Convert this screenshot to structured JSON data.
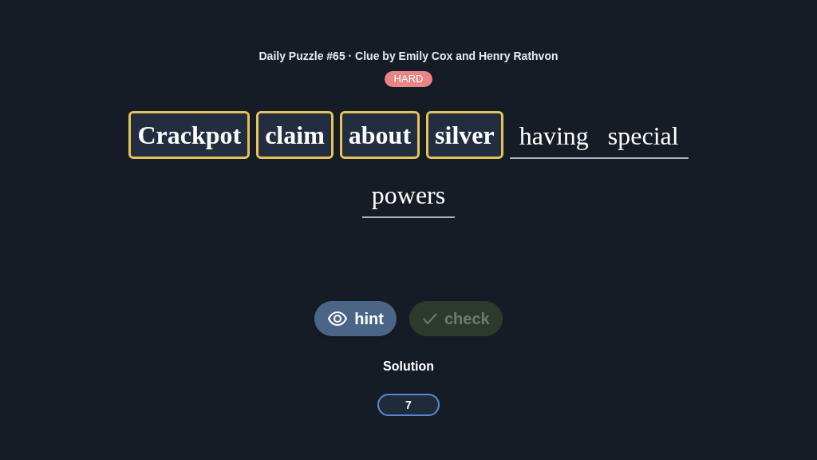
{
  "header": {
    "title": "Daily Puzzle #65 · Clue by Emily Cox and Henry Rathvon",
    "difficulty": "HARD"
  },
  "clue_lines": [
    [
      {
        "kind": "wordplay",
        "text": "Crackpot"
      },
      {
        "kind": "wordplay",
        "text": "claim"
      },
      {
        "kind": "wordplay",
        "text": "about"
      },
      {
        "kind": "wordplay",
        "text": "silver"
      },
      {
        "kind": "definition",
        "text": "having special"
      }
    ],
    [
      {
        "kind": "definition",
        "text": "powers"
      }
    ]
  ],
  "buttons": [
    {
      "kind": "hint",
      "label": "hint",
      "disabled": false
    },
    {
      "kind": "check",
      "label": "check",
      "disabled": true
    }
  ],
  "solution": {
    "label": "Solution",
    "value": "7"
  }
}
